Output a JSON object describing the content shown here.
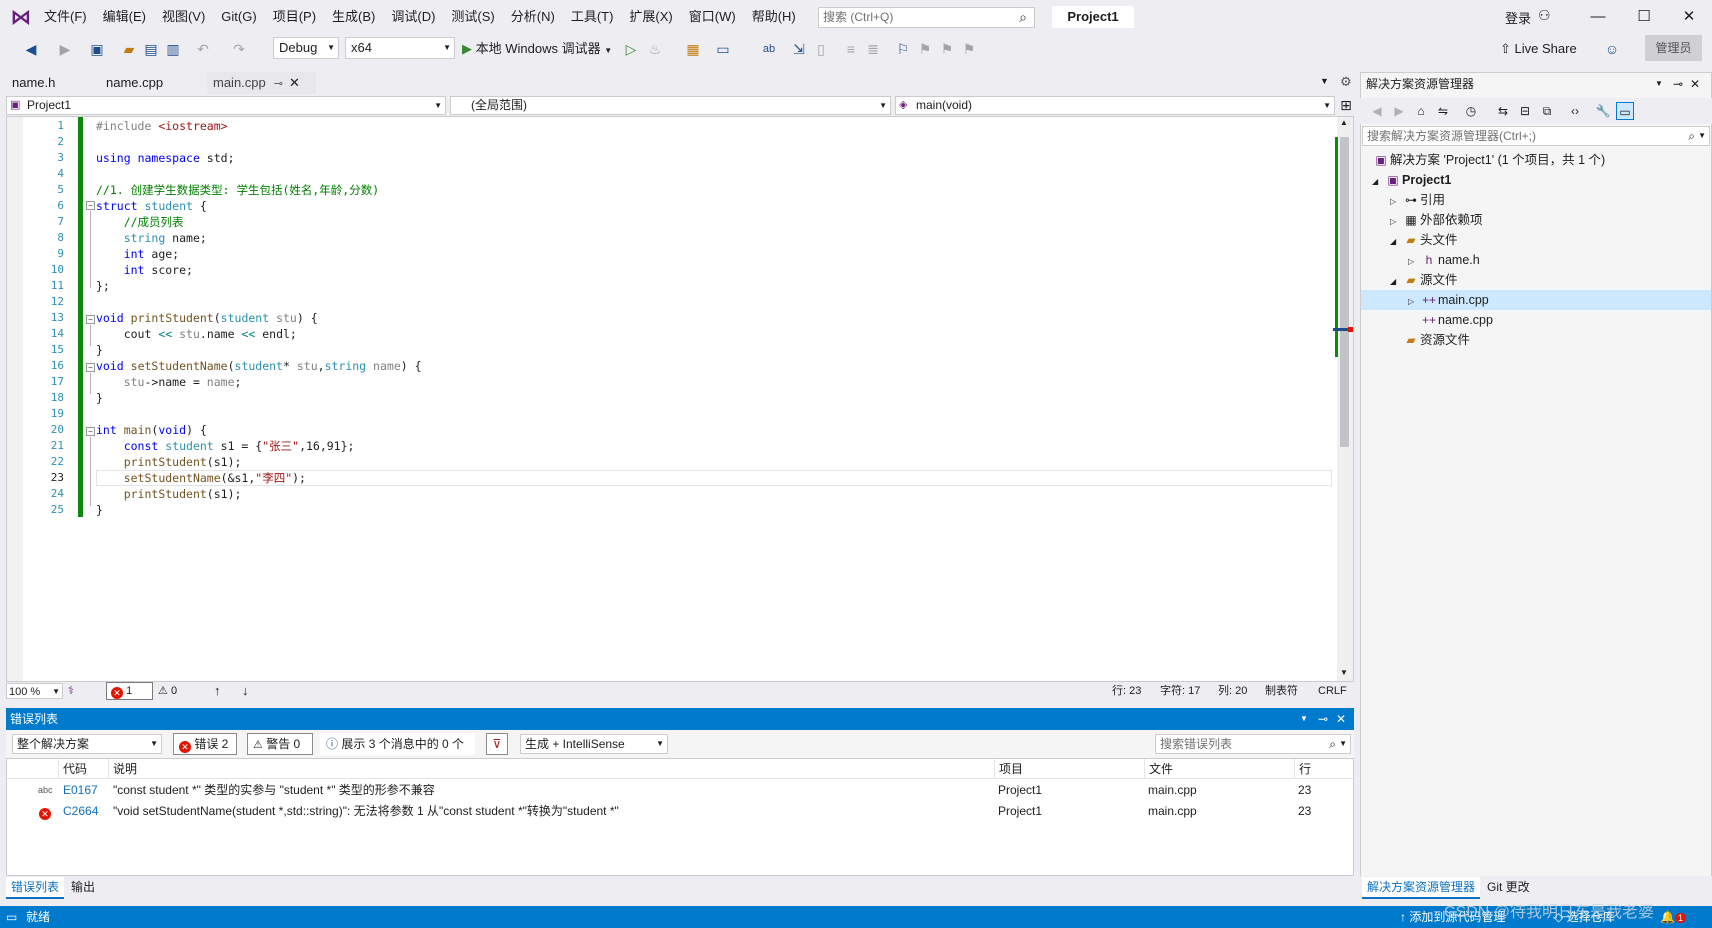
{
  "app": {
    "project_title": "Project1"
  },
  "menu": [
    "文件(F)",
    "编辑(E)",
    "视图(V)",
    "Git(G)",
    "项目(P)",
    "生成(B)",
    "调试(D)",
    "测试(S)",
    "分析(N)",
    "工具(T)",
    "扩展(X)",
    "窗口(W)",
    "帮助(H)"
  ],
  "search": {
    "placeholder": "搜索 (Ctrl+Q)"
  },
  "account": {
    "login": "登录"
  },
  "toolbar": {
    "config": "Debug",
    "platform": "x64",
    "run_label": "本地 Windows 调试器",
    "liveshare": "Live Share",
    "admin": "管理员"
  },
  "tabs": [
    {
      "label": "name.h"
    },
    {
      "label": "name.cpp"
    },
    {
      "label": "main.cpp",
      "active": true
    }
  ],
  "navbar": {
    "project": "Project1",
    "scope": "(全局范围)",
    "member": "main(void)"
  },
  "editor": {
    "current_line": 23,
    "line_numbers": [
      "1",
      "2",
      "3",
      "4",
      "5",
      "6",
      "7",
      "8",
      "9",
      "10",
      "11",
      "12",
      "13",
      "14",
      "15",
      "16",
      "17",
      "18",
      "19",
      "20",
      "21",
      "22",
      "23",
      "24",
      "25"
    ]
  },
  "editor_status": {
    "zoom": "100 %",
    "errors": "1",
    "warnings": "0",
    "line": "行: 23",
    "char": "字符: 17",
    "col": "列: 20",
    "tabs": "制表符",
    "eol": "CRLF"
  },
  "error_list": {
    "title": "错误列表",
    "scope": "整个解决方案",
    "errors_btn": "错误 2",
    "warnings_btn": "警告 0",
    "messages_btn": "展示 3 个消息中的 0 个",
    "source": "生成 + IntelliSense",
    "search_placeholder": "搜索错误列表",
    "columns": [
      "代码",
      "说明",
      "项目",
      "文件",
      "行"
    ],
    "rows": [
      {
        "code": "E0167",
        "desc": "\"const student *\" 类型的实参与 \"student *\" 类型的形参不兼容",
        "project": "Project1",
        "file": "main.cpp",
        "line": "23",
        "kind": "intellisense"
      },
      {
        "code": "C2664",
        "desc": "\"void setStudentName(student *,std::string)\": 无法将参数 1 从\"const student *\"转换为\"student *\"",
        "project": "Project1",
        "file": "main.cpp",
        "line": "23",
        "kind": "error"
      }
    ],
    "bottom_tabs": [
      "错误列表",
      "输出"
    ]
  },
  "solution_explorer": {
    "title": "解决方案资源管理器",
    "search_placeholder": "搜索解决方案资源管理器(Ctrl+;)",
    "tree": {
      "solution": "解决方案 'Project1' (1 个项目，共 1 个)",
      "project": "Project1",
      "references": "引用",
      "external": "外部依赖项",
      "headers": "头文件",
      "header_file": "name.h",
      "sources": "源文件",
      "source_main": "main.cpp",
      "source_name": "name.cpp",
      "resources": "资源文件"
    },
    "bottom_tabs": [
      "解决方案资源管理器",
      "Git 更改"
    ]
  },
  "statusbar": {
    "ready": "就绪",
    "add_source_control": "添加到源代码管理",
    "select_repo": "选择仓库",
    "notifications": "1"
  },
  "watermark": "CSDN @待我明日东是我老婆",
  "colors": {
    "accent": "#007acc",
    "vs_purple": "#68217a",
    "error": "#e51400",
    "change_bar": "#108810"
  }
}
